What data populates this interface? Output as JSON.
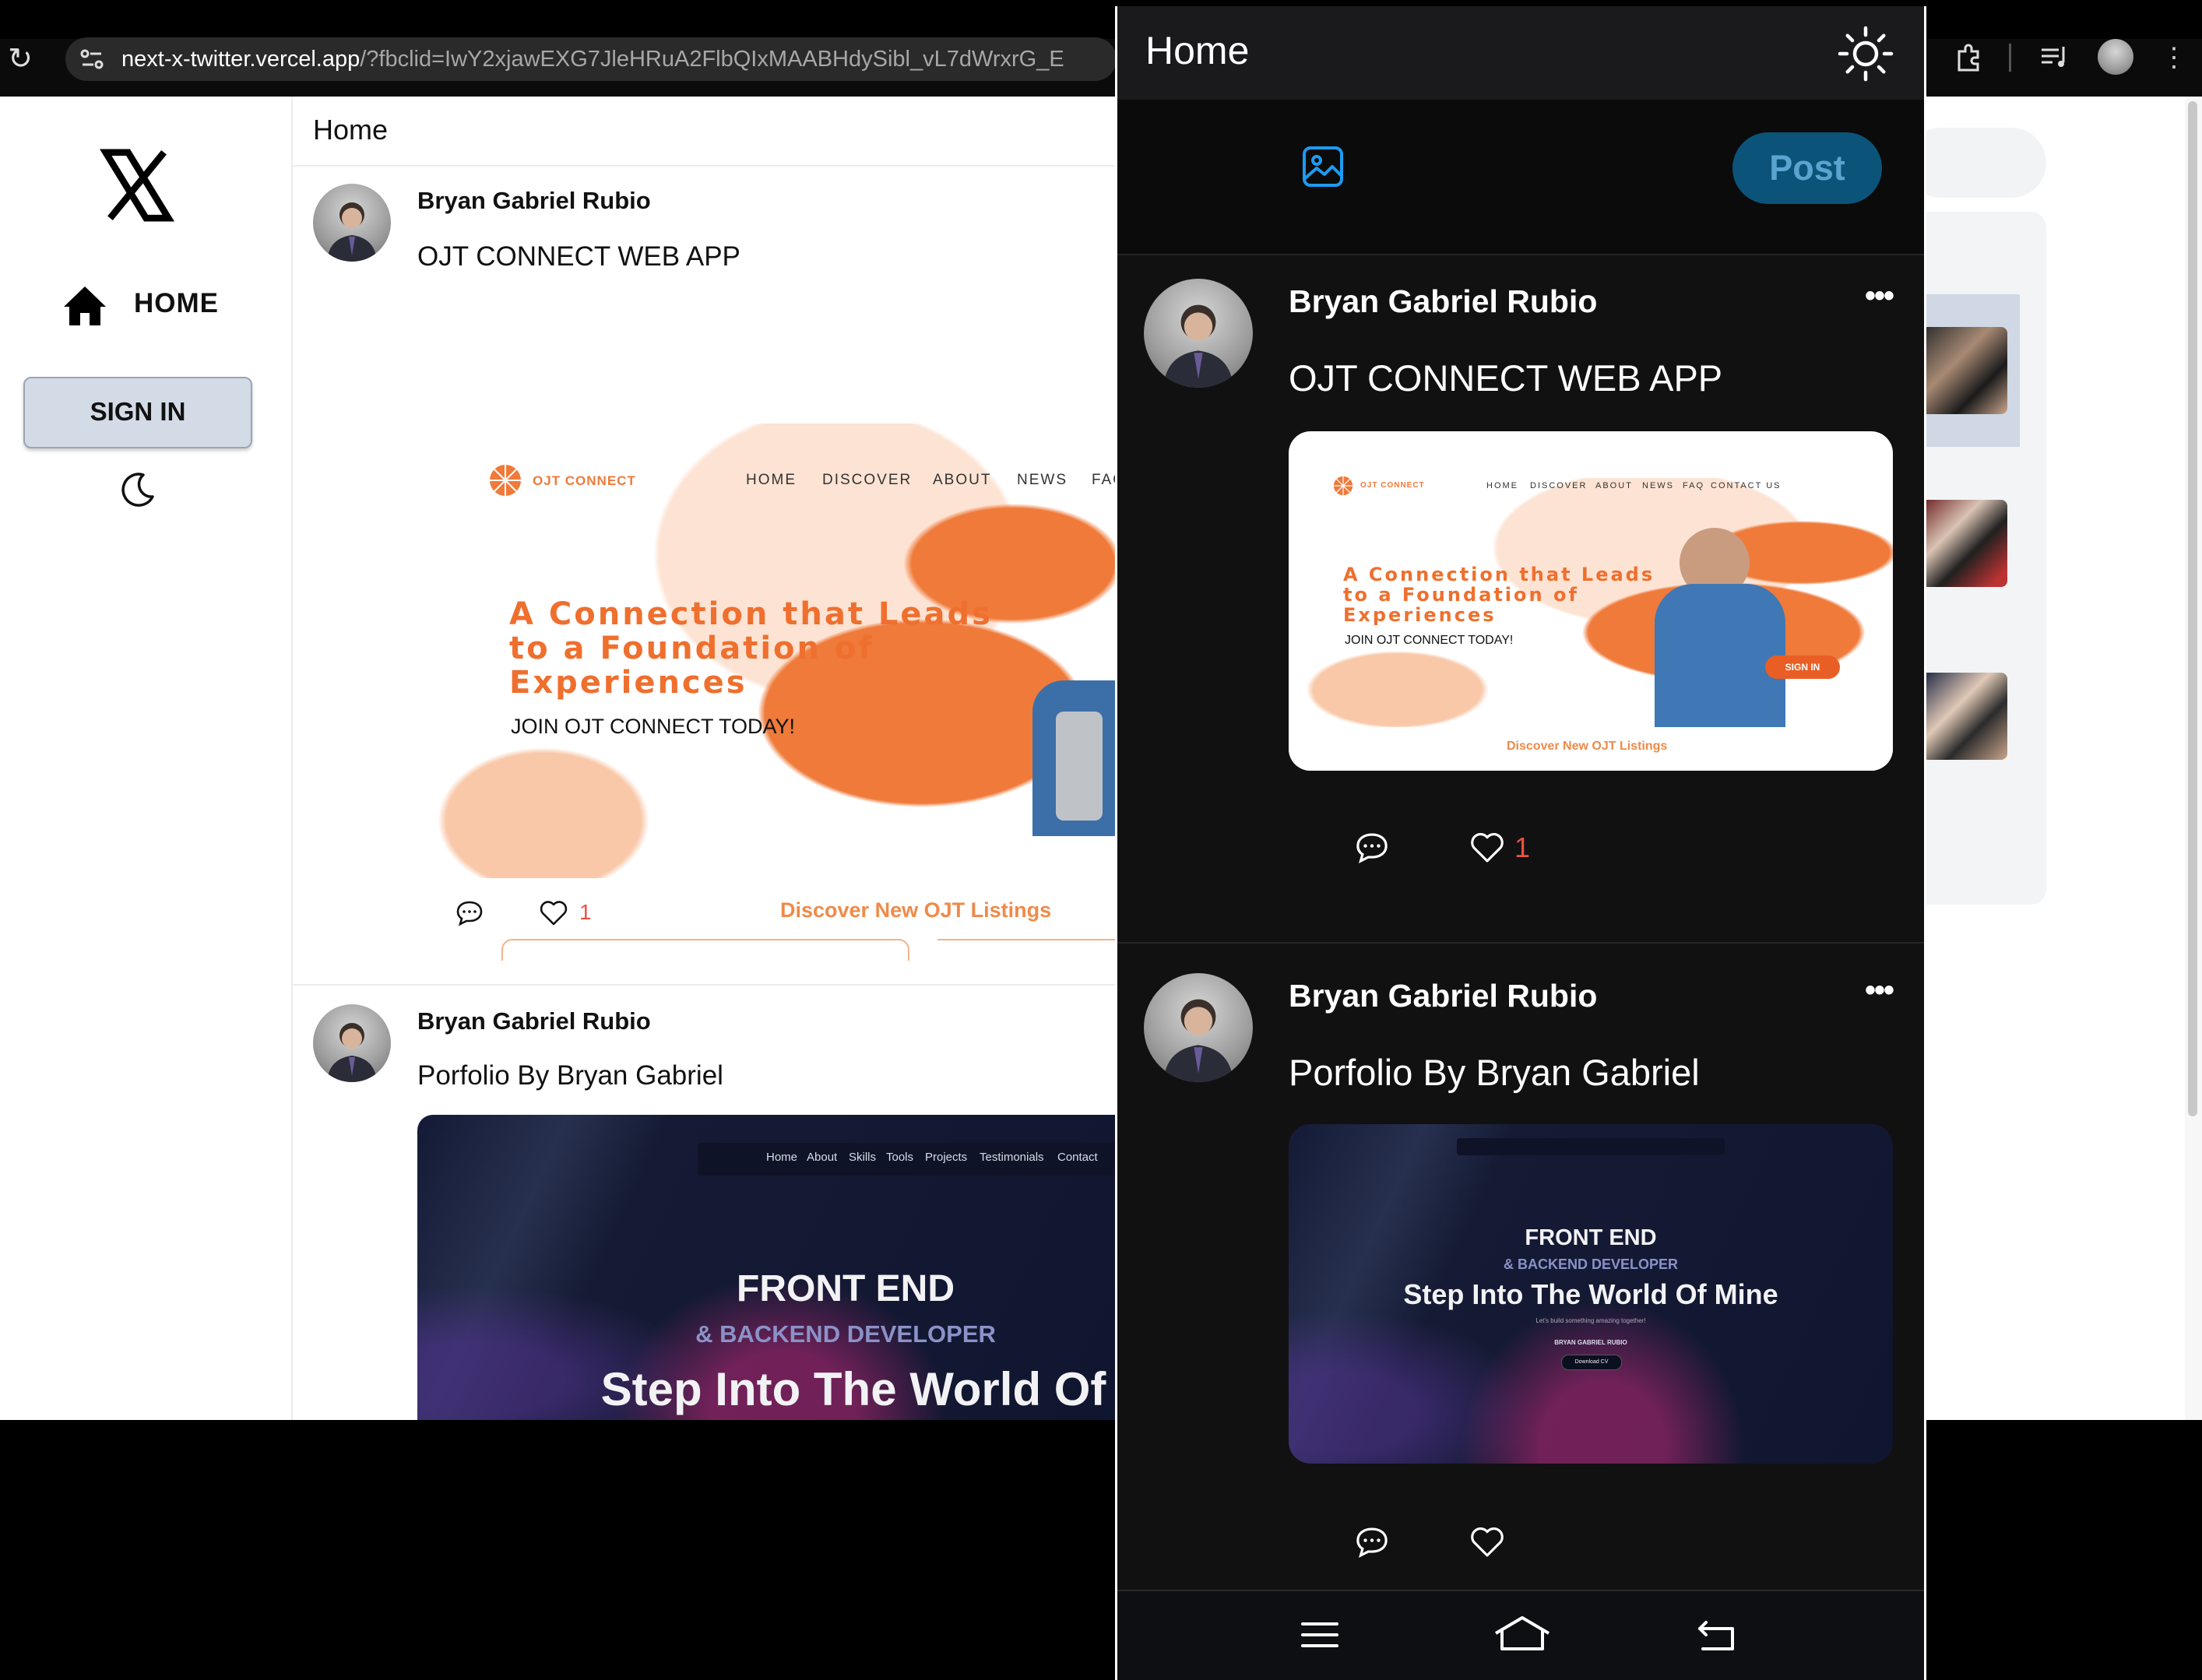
{
  "browser": {
    "url_host": "next-x-twitter.vercel.app",
    "url_rest": "/?fbclid=IwY2xjawEXG7JleHRuA2FlbQIxMAABHdySibl_vL7dWrxrG_E",
    "icons": [
      "reload-icon",
      "site-settings-icon",
      "extensions-icon",
      "media-controls-icon",
      "profile-avatar",
      "more-menu-icon"
    ]
  },
  "desktop": {
    "sidebar": {
      "home_label": "HOME",
      "signin_label": "SIGN IN"
    },
    "feed_title": "Home",
    "posts": [
      {
        "author": "Bryan Gabriel Rubio",
        "text": "OJT CONNECT WEB APP",
        "likes": "1",
        "preview": {
          "logo": "OJT CONNECT",
          "nav": [
            "HOME",
            "DISCOVER",
            "ABOUT",
            "NEWS",
            "FAQ"
          ],
          "headline_1": "A Connection that Leads",
          "headline_2": "to a Foundation of",
          "headline_3": "Experiences",
          "sub": "JOIN OJT CONNECT TODAY!",
          "discover": "Discover New OJT Listings"
        }
      },
      {
        "author": "Bryan Gabriel Rubio",
        "text": "Porfolio By Bryan Gabriel",
        "preview": {
          "nav": [
            "Home",
            "About",
            "Skills",
            "Tools",
            "Projects",
            "Testimonials",
            "Contact"
          ],
          "line_1": "FRONT END",
          "line_2": "& BACKEND DEVELOPER",
          "line_3": "Step Into The World Of"
        }
      }
    ]
  },
  "mobile": {
    "header_title": "Home",
    "post_button": "Post",
    "posts": [
      {
        "author": "Bryan Gabriel Rubio",
        "text": "OJT CONNECT WEB APP",
        "likes": "1",
        "preview": {
          "logo": "OJT CONNECT",
          "nav": [
            "HOME",
            "DISCOVER",
            "ABOUT",
            "NEWS",
            "FAQ",
            "CONTACT US"
          ],
          "headline_1": "A Connection that Leads",
          "headline_2": "to a Foundation of",
          "headline_3": "Experiences",
          "sub": "JOIN OJT CONNECT TODAY!",
          "signin": "SIGN IN",
          "discover": "Discover New OJT Listings"
        }
      },
      {
        "author": "Bryan Gabriel Rubio",
        "text": "Porfolio By Bryan Gabriel",
        "preview": {
          "line_1": "FRONT END",
          "line_2": "& BACKEND DEVELOPER",
          "line_3": "Step Into The World Of Mine",
          "tagline": "Let's build something amazing together!",
          "name": "BRYAN GABRIEL RUBIO",
          "cv": "Download CV"
        }
      }
    ]
  },
  "colors": {
    "brand_orange": "#ef7a3a",
    "like_red": "#e8533f",
    "post_button_bg": "#0c5379",
    "image_icon_blue": "#1d9bf0"
  }
}
